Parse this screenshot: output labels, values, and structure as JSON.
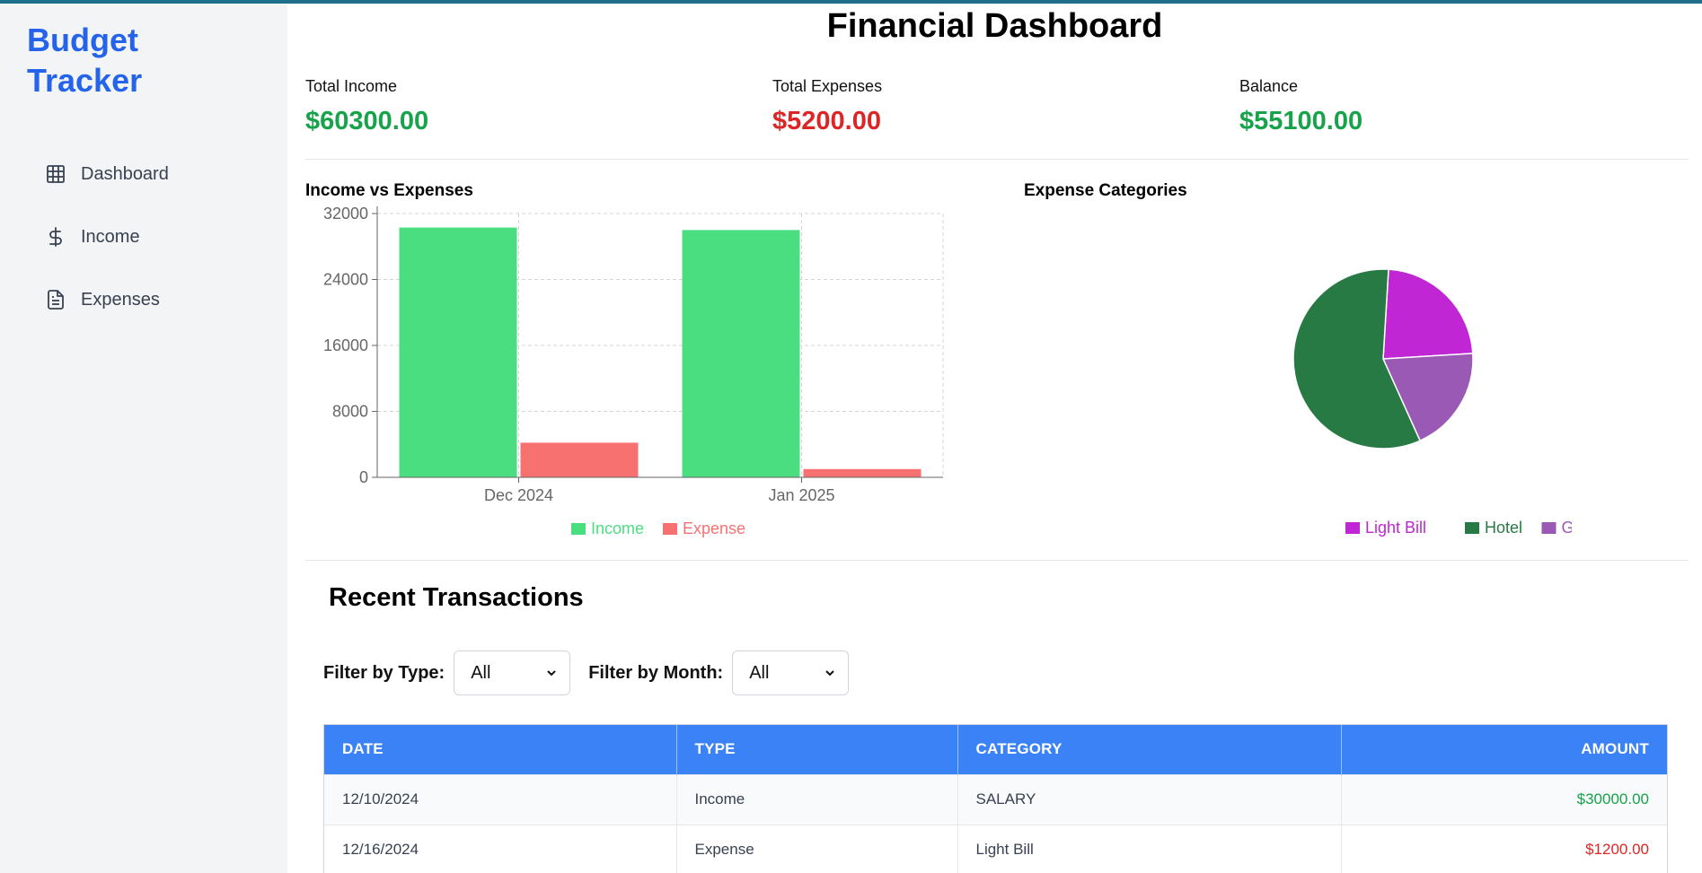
{
  "sidebar": {
    "brand": "Budget Tracker",
    "items": [
      {
        "label": "Dashboard",
        "icon": "grid-icon"
      },
      {
        "label": "Income",
        "icon": "dollar-icon"
      },
      {
        "label": "Expenses",
        "icon": "document-icon"
      }
    ]
  },
  "header": {
    "title": "Financial Dashboard"
  },
  "stats": {
    "income_label": "Total Income",
    "income_value": "$60300.00",
    "expenses_label": "Total Expenses",
    "expenses_value": "$5200.00",
    "balance_label": "Balance",
    "balance_value": "$55100.00"
  },
  "colors": {
    "brand": "#2563eb",
    "positive": "#16a34a",
    "negative": "#dc2626",
    "income_bar": "#4ade80",
    "expense_bar": "#f87171",
    "table_header": "#3b82f6"
  },
  "chart_data": [
    {
      "type": "bar",
      "title": "Income vs Expenses",
      "categories": [
        "Dec 2024",
        "Jan 2025"
      ],
      "series": [
        {
          "name": "Income",
          "values": [
            30300,
            30000
          ],
          "color": "#4ade80"
        },
        {
          "name": "Expense",
          "values": [
            4200,
            1000
          ],
          "color": "#f87171"
        }
      ],
      "yticks": [
        0,
        8000,
        16000,
        24000,
        32000
      ],
      "ylim": [
        0,
        32000
      ],
      "grid": true,
      "legend": "bottom"
    },
    {
      "type": "pie",
      "title": "Expense Categories",
      "slices": [
        {
          "label": "Light Bill",
          "value": 1200,
          "color": "#c026d3"
        },
        {
          "label": "Hotel",
          "value": 3000,
          "color": "#277a44"
        },
        {
          "label": "Grocery",
          "value": 1000,
          "color": "#9b59b6"
        }
      ],
      "legend": "bottom"
    }
  ],
  "transactions": {
    "title": "Recent Transactions",
    "filter_type_label": "Filter by Type:",
    "filter_type_value": "All",
    "filter_month_label": "Filter by Month:",
    "filter_month_value": "All",
    "columns": [
      "DATE",
      "TYPE",
      "CATEGORY",
      "AMOUNT"
    ],
    "rows": [
      {
        "date": "12/10/2024",
        "type": "Income",
        "category": "SALARY",
        "amount": "$30000.00",
        "kind": "income"
      },
      {
        "date": "12/16/2024",
        "type": "Expense",
        "category": "Light Bill",
        "amount": "$1200.00",
        "kind": "expense"
      }
    ]
  }
}
